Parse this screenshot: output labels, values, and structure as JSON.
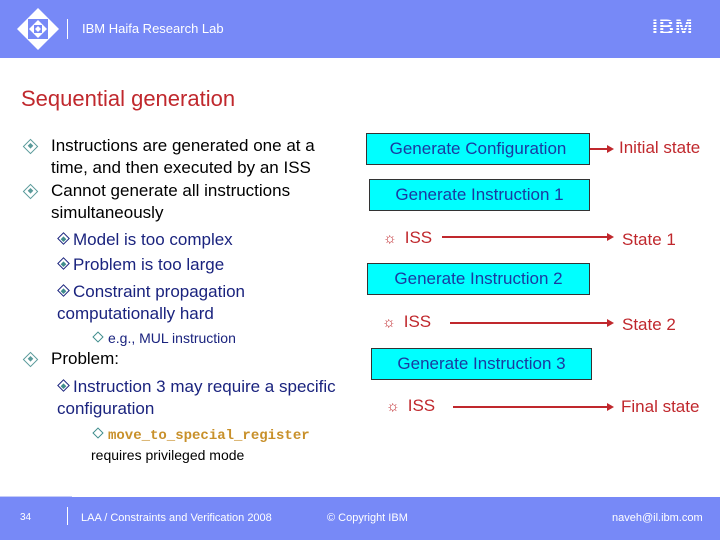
{
  "header": {
    "lab_name": "IBM Haifa Research Lab",
    "logo_icon": "ibm-research-diamond-logo",
    "brand_logo": "IBM",
    "background_color": "#7789f7"
  },
  "slide": {
    "title": "Sequential generation",
    "title_color": "#c0282d",
    "bullets": {
      "b1": {
        "line1": "Instructions are generated one at a",
        "line2": "time, and then executed by an ISS"
      },
      "b2": {
        "line1": "Cannot generate all instructions",
        "line2": "simultaneously",
        "subs": {
          "s1": "Model is too complex",
          "s2": "Problem is too large",
          "s3_line1": "Constraint propagation",
          "s3_line2": "computationally hard",
          "s3_sub": "e.g., MUL instruction"
        }
      },
      "b3": {
        "line1": "Problem:",
        "sub_line1": "Instruction 3 may require a specific",
        "sub_line2": "configuration",
        "subsub_code": "move_to_special_register",
        "subsub_text": "requires privileged mode"
      }
    },
    "flow": {
      "box_color": "#00ffff",
      "arrow_color": "#c0282d",
      "steps": [
        {
          "box": "Generate Configuration",
          "state": "Initial state"
        },
        {
          "box": "Generate Instruction 1",
          "iss": "ISS",
          "state": "State 1"
        },
        {
          "box": "Generate Instruction 2",
          "iss": "ISS",
          "state": "State 2"
        },
        {
          "box": "Generate Instruction 3",
          "iss": "ISS",
          "state": "Final state"
        }
      ]
    }
  },
  "footer": {
    "page_number": "34",
    "course": "LAA / Constraints and Verification 2008",
    "copyright": "© Copyright IBM",
    "email": "naveh@il.ibm.com"
  }
}
